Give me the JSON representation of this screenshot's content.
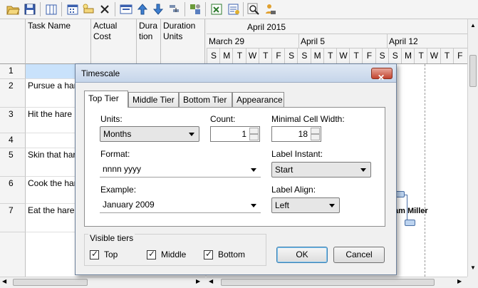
{
  "grid": {
    "headers": {
      "task_name": "Task Name",
      "actual_cost": "Actual Cost",
      "duration": "Duration",
      "duration_units": "Duration Units"
    },
    "rows": [
      {
        "num": "1",
        "name": ""
      },
      {
        "num": "2",
        "name": "Pursue a hare"
      },
      {
        "num": "3",
        "name": "Hit the hare"
      },
      {
        "num": "4",
        "name": ""
      },
      {
        "num": "5",
        "name": "Skin that hare"
      },
      {
        "num": "6",
        "name": "Cook the hare"
      },
      {
        "num": "7",
        "name": "Eat the hare"
      }
    ]
  },
  "timescale_header": {
    "month": "April 2015",
    "weeks": [
      "March 29",
      "April 5",
      "April 12"
    ],
    "days": [
      "S",
      "M",
      "T",
      "W",
      "T",
      "F",
      "S",
      "S",
      "M",
      "T",
      "W",
      "T",
      "F",
      "S",
      "S",
      "M",
      "T",
      "W",
      "T",
      "F"
    ]
  },
  "gantt": {
    "resource_label": "am Miller"
  },
  "dialog": {
    "title": "Timescale",
    "tabs": [
      "Top Tier",
      "Middle Tier",
      "Bottom Tier",
      "Appearance"
    ],
    "units_label": "Units:",
    "units_value": "Months",
    "count_label": "Count:",
    "count_value": "1",
    "min_cell_label": "Minimal Cell Width:",
    "min_cell_value": "18",
    "format_label": "Format:",
    "format_value": "nnnn yyyy",
    "label_instant_label": "Label Instant:",
    "label_instant_value": "Start",
    "example_label": "Example:",
    "example_value": "January 2009",
    "label_align_label": "Label Align:",
    "label_align_value": "Left",
    "visible_tiers_label": "Visible tiers",
    "tiers": [
      "Top",
      "Middle",
      "Bottom"
    ],
    "ok_label": "OK",
    "cancel_label": "Cancel"
  },
  "colors": {
    "selected_row": "#c9e2fb",
    "ok_border": "#3c7fb1"
  }
}
